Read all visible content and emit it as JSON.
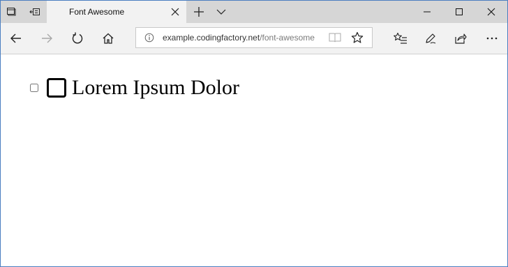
{
  "tab": {
    "title": "Font Awesome"
  },
  "address_bar": {
    "host": "example.codingfactory.net",
    "path": "/font-awesome"
  },
  "page": {
    "text": "Lorem Ipsum Dolor",
    "checkbox_checked": false
  },
  "icons": {
    "tab_actions": "tab-actions-icon",
    "set_aside_tabs": "set-aside-tabs-icon",
    "new_tab": "plus-icon",
    "tab_list": "chevron-down-icon",
    "minimize": "minimize-icon",
    "maximize": "maximize-icon",
    "close": "close-icon",
    "back": "back-arrow-icon",
    "forward": "forward-arrow-icon",
    "refresh": "refresh-icon",
    "home": "home-icon",
    "info": "info-icon",
    "reading_view": "book-icon",
    "favorite": "star-icon",
    "favorites_hub": "favorites-list-icon",
    "notes": "pen-icon",
    "share": "share-icon",
    "more": "more-icon",
    "square_icon": "square-o-icon"
  }
}
